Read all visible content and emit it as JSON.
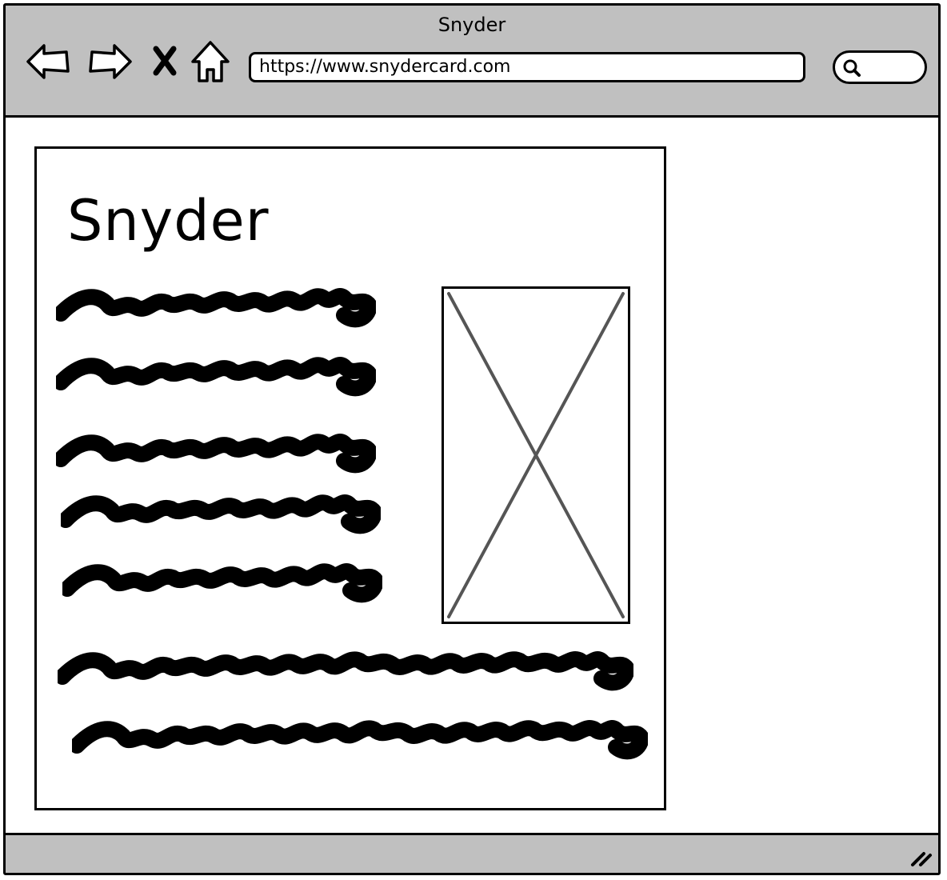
{
  "window": {
    "title": "Snyder"
  },
  "toolbar": {
    "back_icon": "back-arrow-icon",
    "forward_icon": "forward-arrow-icon",
    "stop_icon": "close-icon",
    "home_icon": "home-icon",
    "url": "https://www.snydercard.com",
    "search_icon": "search-icon"
  },
  "card": {
    "title": "Snyder",
    "image_icon": "image-placeholder-icon"
  },
  "colors": {
    "chrome": "#c0c0c0",
    "stroke": "#000000",
    "placeholder_cross": "#555555"
  }
}
